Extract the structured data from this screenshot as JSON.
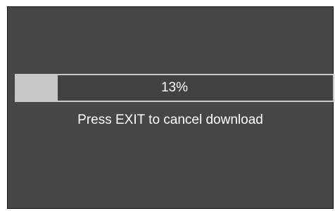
{
  "download": {
    "progress_fraction": 0.13,
    "progress_label": "13%",
    "message": "Press EXIT to cancel download"
  },
  "colors": {
    "background": "#464646",
    "bar_border": "#c8c8c8",
    "bar_fill": "#c7c7c7",
    "text": "#ffffff"
  }
}
